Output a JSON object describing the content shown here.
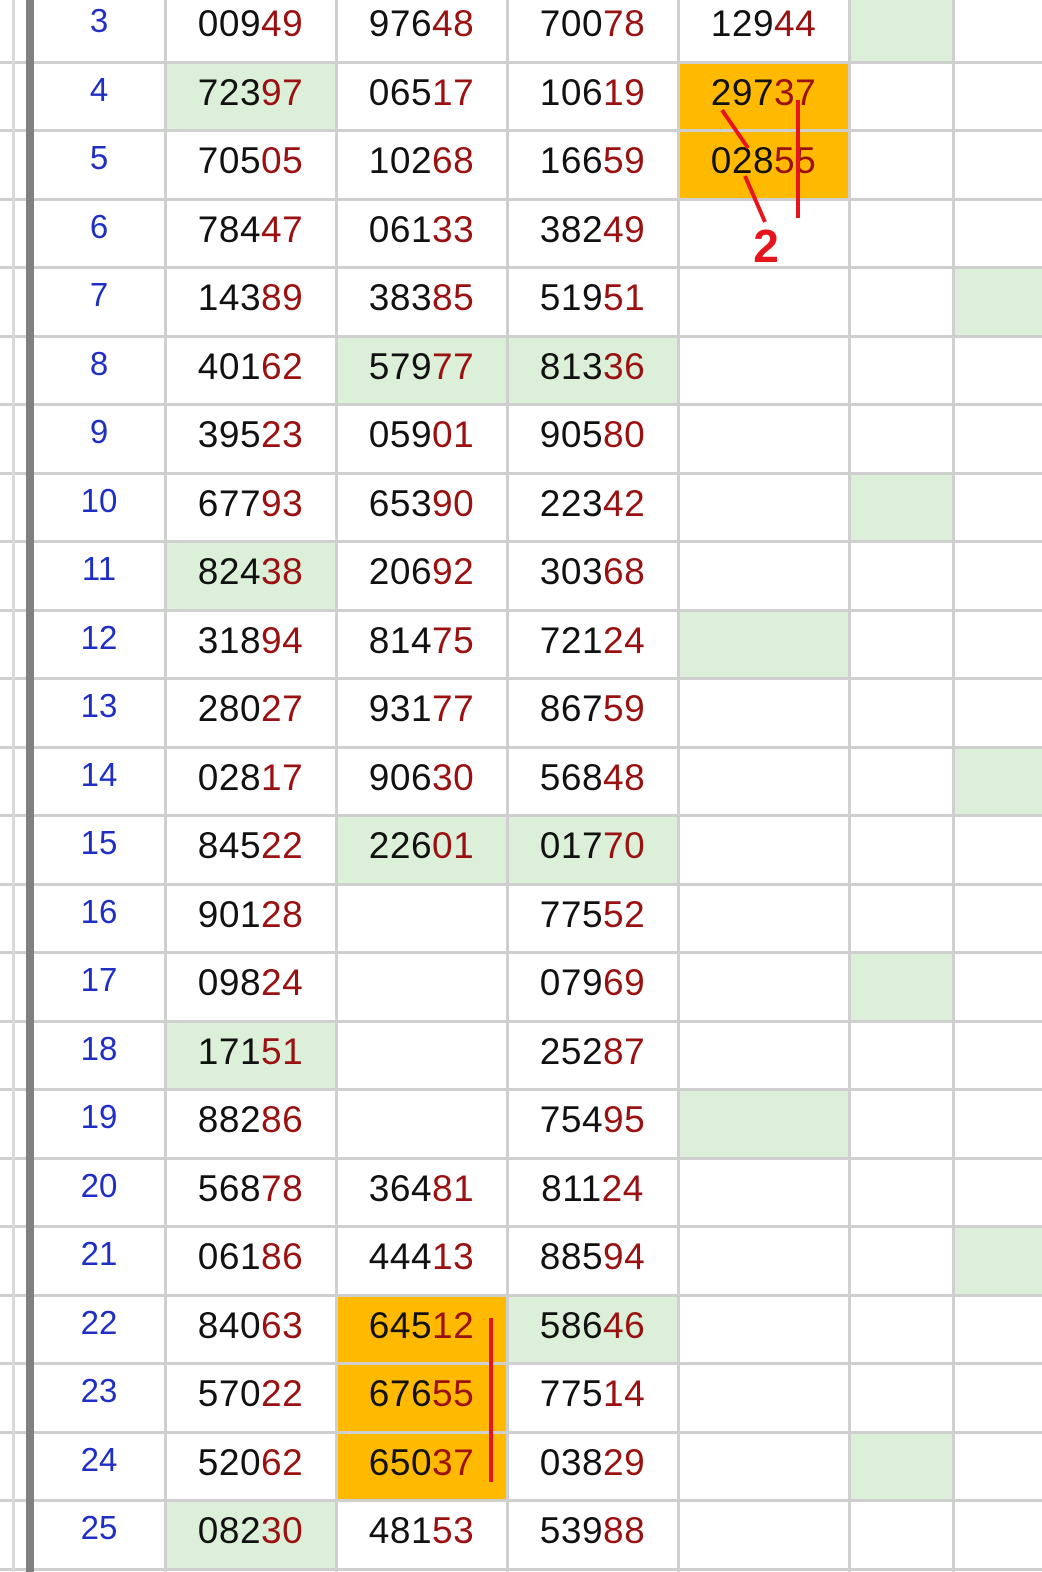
{
  "colors": {
    "row_number": "#1f2fc4",
    "digits": "#111111",
    "tail_digits": "#9b1111",
    "highlight_green": "#dcefd8",
    "highlight_orange": "#ffba00",
    "annotation_red": "#e8141c"
  },
  "rows": [
    {
      "n": "3",
      "cells": [
        {
          "h": "009",
          "t": "49",
          "bg": ""
        },
        {
          "h": "976",
          "t": "48",
          "bg": ""
        },
        {
          "h": "700",
          "t": "78",
          "bg": ""
        },
        {
          "h": "129",
          "t": "44",
          "bg": ""
        }
      ],
      "extra": [
        "green",
        ""
      ]
    },
    {
      "n": "4",
      "cells": [
        {
          "h": "723",
          "t": "97",
          "bg": "green"
        },
        {
          "h": "065",
          "t": "17",
          "bg": ""
        },
        {
          "h": "106",
          "t": "19",
          "bg": ""
        },
        {
          "h": "297",
          "t": "37",
          "bg": "orange"
        }
      ],
      "extra": [
        "",
        ""
      ]
    },
    {
      "n": "5",
      "cells": [
        {
          "h": "705",
          "t": "05",
          "bg": ""
        },
        {
          "h": "102",
          "t": "68",
          "bg": ""
        },
        {
          "h": "166",
          "t": "59",
          "bg": ""
        },
        {
          "h": "028",
          "t": "55",
          "bg": "orange"
        }
      ],
      "extra": [
        "",
        ""
      ]
    },
    {
      "n": "6",
      "cells": [
        {
          "h": "784",
          "t": "47",
          "bg": ""
        },
        {
          "h": "061",
          "t": "33",
          "bg": ""
        },
        {
          "h": "382",
          "t": "49",
          "bg": ""
        },
        {
          "h": "",
          "t": "",
          "bg": ""
        }
      ],
      "extra": [
        "",
        ""
      ]
    },
    {
      "n": "7",
      "cells": [
        {
          "h": "143",
          "t": "89",
          "bg": ""
        },
        {
          "h": "383",
          "t": "85",
          "bg": ""
        },
        {
          "h": "519",
          "t": "51",
          "bg": ""
        },
        {
          "h": "",
          "t": "",
          "bg": ""
        }
      ],
      "extra": [
        "",
        "green"
      ]
    },
    {
      "n": "8",
      "cells": [
        {
          "h": "401",
          "t": "62",
          "bg": ""
        },
        {
          "h": "579",
          "t": "77",
          "bg": "green"
        },
        {
          "h": "813",
          "t": "36",
          "bg": "green"
        },
        {
          "h": "",
          "t": "",
          "bg": ""
        }
      ],
      "extra": [
        "",
        ""
      ]
    },
    {
      "n": "9",
      "cells": [
        {
          "h": "395",
          "t": "23",
          "bg": ""
        },
        {
          "h": "059",
          "t": "01",
          "bg": ""
        },
        {
          "h": "905",
          "t": "80",
          "bg": ""
        },
        {
          "h": "",
          "t": "",
          "bg": ""
        }
      ],
      "extra": [
        "",
        ""
      ]
    },
    {
      "n": "10",
      "cells": [
        {
          "h": "677",
          "t": "93",
          "bg": ""
        },
        {
          "h": "653",
          "t": "90",
          "bg": ""
        },
        {
          "h": "223",
          "t": "42",
          "bg": ""
        },
        {
          "h": "",
          "t": "",
          "bg": ""
        }
      ],
      "extra": [
        "green",
        ""
      ]
    },
    {
      "n": "11",
      "cells": [
        {
          "h": "824",
          "t": "38",
          "bg": "green"
        },
        {
          "h": "206",
          "t": "92",
          "bg": ""
        },
        {
          "h": "303",
          "t": "68",
          "bg": ""
        },
        {
          "h": "",
          "t": "",
          "bg": ""
        }
      ],
      "extra": [
        "",
        ""
      ]
    },
    {
      "n": "12",
      "cells": [
        {
          "h": "318",
          "t": "94",
          "bg": ""
        },
        {
          "h": "814",
          "t": "75",
          "bg": ""
        },
        {
          "h": "721",
          "t": "24",
          "bg": ""
        },
        {
          "h": "",
          "t": "",
          "bg": "green"
        }
      ],
      "extra": [
        "",
        ""
      ]
    },
    {
      "n": "13",
      "cells": [
        {
          "h": "280",
          "t": "27",
          "bg": ""
        },
        {
          "h": "931",
          "t": "77",
          "bg": ""
        },
        {
          "h": "867",
          "t": "59",
          "bg": ""
        },
        {
          "h": "",
          "t": "",
          "bg": ""
        }
      ],
      "extra": [
        "",
        ""
      ]
    },
    {
      "n": "14",
      "cells": [
        {
          "h": "028",
          "t": "17",
          "bg": ""
        },
        {
          "h": "906",
          "t": "30",
          "bg": ""
        },
        {
          "h": "568",
          "t": "48",
          "bg": ""
        },
        {
          "h": "",
          "t": "",
          "bg": ""
        }
      ],
      "extra": [
        "",
        "green"
      ]
    },
    {
      "n": "15",
      "cells": [
        {
          "h": "845",
          "t": "22",
          "bg": ""
        },
        {
          "h": "226",
          "t": "01",
          "bg": "green"
        },
        {
          "h": "017",
          "t": "70",
          "bg": "green"
        },
        {
          "h": "",
          "t": "",
          "bg": ""
        }
      ],
      "extra": [
        "",
        ""
      ]
    },
    {
      "n": "16",
      "cells": [
        {
          "h": "901",
          "t": "28",
          "bg": ""
        },
        {
          "h": "",
          "t": "",
          "bg": ""
        },
        {
          "h": "775",
          "t": "52",
          "bg": ""
        },
        {
          "h": "",
          "t": "",
          "bg": ""
        }
      ],
      "extra": [
        "",
        ""
      ]
    },
    {
      "n": "17",
      "cells": [
        {
          "h": "098",
          "t": "24",
          "bg": ""
        },
        {
          "h": "",
          "t": "",
          "bg": ""
        },
        {
          "h": "079",
          "t": "69",
          "bg": ""
        },
        {
          "h": "",
          "t": "",
          "bg": ""
        }
      ],
      "extra": [
        "green",
        ""
      ]
    },
    {
      "n": "18",
      "cells": [
        {
          "h": "171",
          "t": "51",
          "bg": "green"
        },
        {
          "h": "",
          "t": "",
          "bg": ""
        },
        {
          "h": "252",
          "t": "87",
          "bg": ""
        },
        {
          "h": "",
          "t": "",
          "bg": ""
        }
      ],
      "extra": [
        "",
        ""
      ]
    },
    {
      "n": "19",
      "cells": [
        {
          "h": "882",
          "t": "86",
          "bg": ""
        },
        {
          "h": "",
          "t": "",
          "bg": ""
        },
        {
          "h": "754",
          "t": "95",
          "bg": ""
        },
        {
          "h": "",
          "t": "",
          "bg": "green"
        }
      ],
      "extra": [
        "",
        ""
      ]
    },
    {
      "n": "20",
      "cells": [
        {
          "h": "568",
          "t": "78",
          "bg": ""
        },
        {
          "h": "364",
          "t": "81",
          "bg": ""
        },
        {
          "h": "811",
          "t": "24",
          "bg": ""
        },
        {
          "h": "",
          "t": "",
          "bg": ""
        }
      ],
      "extra": [
        "",
        ""
      ]
    },
    {
      "n": "21",
      "cells": [
        {
          "h": "061",
          "t": "86",
          "bg": ""
        },
        {
          "h": "444",
          "t": "13",
          "bg": ""
        },
        {
          "h": "885",
          "t": "94",
          "bg": ""
        },
        {
          "h": "",
          "t": "",
          "bg": ""
        }
      ],
      "extra": [
        "",
        "green"
      ]
    },
    {
      "n": "22",
      "cells": [
        {
          "h": "840",
          "t": "63",
          "bg": ""
        },
        {
          "h": "645",
          "t": "12",
          "bg": "orange"
        },
        {
          "h": "586",
          "t": "46",
          "bg": "green"
        },
        {
          "h": "",
          "t": "",
          "bg": ""
        }
      ],
      "extra": [
        "",
        ""
      ]
    },
    {
      "n": "23",
      "cells": [
        {
          "h": "570",
          "t": "22",
          "bg": ""
        },
        {
          "h": "676",
          "t": "55",
          "bg": "orange"
        },
        {
          "h": "775",
          "t": "14",
          "bg": ""
        },
        {
          "h": "",
          "t": "",
          "bg": ""
        }
      ],
      "extra": [
        "",
        ""
      ]
    },
    {
      "n": "24",
      "cells": [
        {
          "h": "520",
          "t": "62",
          "bg": ""
        },
        {
          "h": "650",
          "t": "37",
          "bg": "orange"
        },
        {
          "h": "038",
          "t": "29",
          "bg": ""
        },
        {
          "h": "",
          "t": "",
          "bg": ""
        }
      ],
      "extra": [
        "green",
        ""
      ]
    },
    {
      "n": "25",
      "cells": [
        {
          "h": "082",
          "t": "30",
          "bg": "green"
        },
        {
          "h": "481",
          "t": "53",
          "bg": ""
        },
        {
          "h": "539",
          "t": "88",
          "bg": ""
        },
        {
          "h": "",
          "t": "",
          "bg": ""
        }
      ],
      "extra": [
        "",
        ""
      ]
    }
  ],
  "annotation": {
    "label": "2"
  }
}
